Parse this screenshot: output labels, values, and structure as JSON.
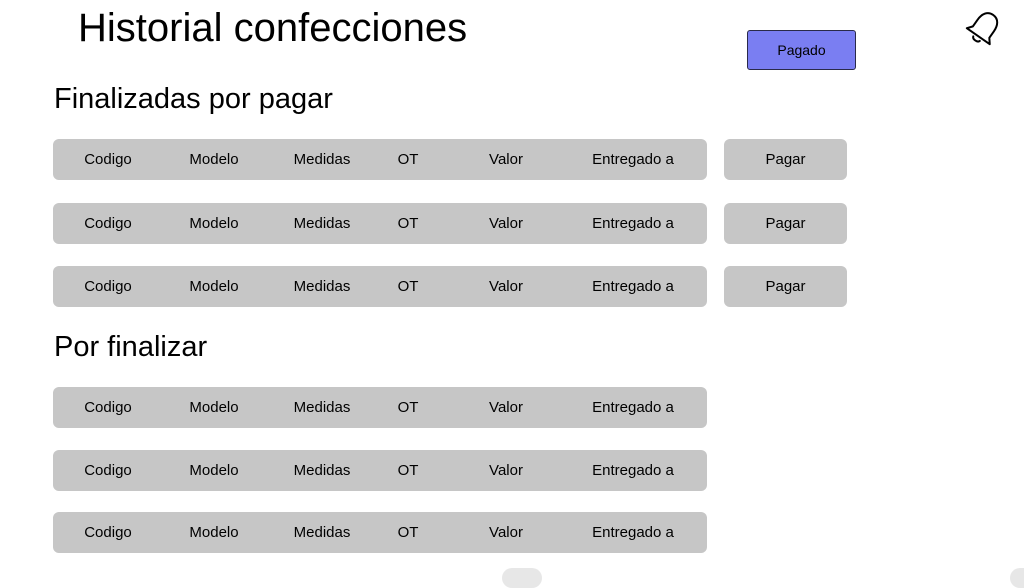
{
  "header": {
    "title": "Historial confecciones",
    "paid_button_label": "Pagado",
    "bell_icon": "bell-icon"
  },
  "colors": {
    "accent": "#7a7ef2",
    "row_background": "#c6c6c6",
    "background": "#ffffff"
  },
  "pending_payment": {
    "title": "Finalizadas por pagar",
    "rows": [
      {
        "codigo": "Codigo",
        "modelo": "Modelo",
        "medidas": "Medidas",
        "ot": "OT",
        "valor": "Valor",
        "entregado": "Entregado a",
        "pay_label": "Pagar"
      },
      {
        "codigo": "Codigo",
        "modelo": "Modelo",
        "medidas": "Medidas",
        "ot": "OT",
        "valor": "Valor",
        "entregado": "Entregado a",
        "pay_label": "Pagar"
      },
      {
        "codigo": "Codigo",
        "modelo": "Modelo",
        "medidas": "Medidas",
        "ot": "OT",
        "valor": "Valor",
        "entregado": "Entregado a",
        "pay_label": "Pagar"
      }
    ]
  },
  "to_finish": {
    "title": "Por finalizar",
    "rows": [
      {
        "codigo": "Codigo",
        "modelo": "Modelo",
        "medidas": "Medidas",
        "ot": "OT",
        "valor": "Valor",
        "entregado": "Entregado a"
      },
      {
        "codigo": "Codigo",
        "modelo": "Modelo",
        "medidas": "Medidas",
        "ot": "OT",
        "valor": "Valor",
        "entregado": "Entregado a"
      },
      {
        "codigo": "Codigo",
        "modelo": "Modelo",
        "medidas": "Medidas",
        "ot": "OT",
        "valor": "Valor",
        "entregado": "Entregado a"
      }
    ]
  }
}
